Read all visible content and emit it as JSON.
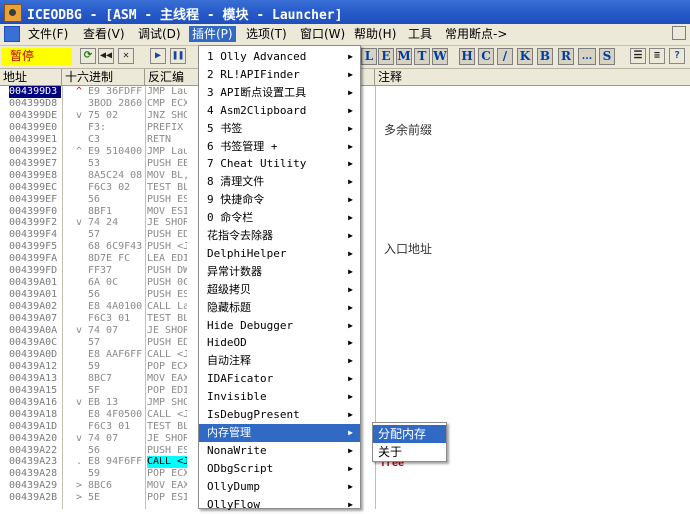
{
  "title": "ICEODBG - [ASM - 主线程 - 模块 - Launcher]",
  "menubar": [
    {
      "label": "文件(F)"
    },
    {
      "label": "查看(V)"
    },
    {
      "label": "调试(D)"
    },
    {
      "label": "插件(P)"
    },
    {
      "label": "选项(T)"
    },
    {
      "label": "窗口(W)"
    },
    {
      "label": "帮助(H)"
    },
    {
      "label": "工具"
    },
    {
      "label": "常用断点->"
    }
  ],
  "toolbar": {
    "status": "暂停",
    "letters": [
      "L",
      "E",
      "M",
      "T",
      "W",
      "H",
      "C",
      "/",
      "K",
      "B",
      "R",
      "...",
      "S"
    ]
  },
  "columns": {
    "addr": "地址",
    "hex": "十六进制",
    "disasm": "反汇编",
    "comment": "注释"
  },
  "rows": [
    {
      "addr": "004399D3",
      "mark": "^",
      "hex": "E9 36FDFF",
      "asm": "JMP Lau"
    },
    {
      "addr": "004399D8",
      "mark": "",
      "hex": "3BOD 2860",
      "asm": "CMP ECX"
    },
    {
      "addr": "004399DE",
      "mark": "v",
      "hex": "75 02",
      "asm": "JNZ SHO"
    },
    {
      "addr": "004399E0",
      "mark": "",
      "hex": "F3:",
      "asm": "PREFIX"
    },
    {
      "addr": "004399E1",
      "mark": "",
      "hex": "C3",
      "asm": "RETN"
    },
    {
      "addr": "004399E2",
      "mark": "^",
      "hex": "E9 510400",
      "asm": "JMP Lau"
    },
    {
      "addr": "004399E7",
      "mark": "",
      "hex": "53",
      "asm": "PUSH EB"
    },
    {
      "addr": "004399E8",
      "mark": "",
      "hex": "8A5C24 08",
      "asm": "MOV BL,"
    },
    {
      "addr": "004399EC",
      "mark": "",
      "hex": "F6C3 02",
      "asm": "TEST BL"
    },
    {
      "addr": "004399EF",
      "mark": "",
      "hex": "56",
      "asm": "PUSH ES"
    },
    {
      "addr": "004399F0",
      "mark": "",
      "hex": "8BF1",
      "asm": "MOV ESI"
    },
    {
      "addr": "004399F2",
      "mark": "v",
      "hex": "74 24",
      "asm": "JE SHOR"
    },
    {
      "addr": "004399F4",
      "mark": "",
      "hex": "57",
      "asm": "PUSH ED"
    },
    {
      "addr": "004399F5",
      "mark": "",
      "hex": "68 6C9F43",
      "asm": "PUSH <J"
    },
    {
      "addr": "004399FA",
      "mark": "",
      "hex": "8D7E FC",
      "asm": "LEA EDI"
    },
    {
      "addr": "004399FD",
      "mark": "",
      "hex": "FF37",
      "asm": "PUSH DW"
    },
    {
      "addr": "00439A01",
      "mark": "",
      "hex": "6A 0C",
      "asm": "PUSH 0C"
    },
    {
      "addr": "00439A01",
      "mark": "",
      "hex": "56",
      "asm": "PUSH ES"
    },
    {
      "addr": "00439A02",
      "mark": "",
      "hex": "E8 4A0100",
      "asm": "CALL La"
    },
    {
      "addr": "00439A07",
      "mark": "",
      "hex": "F6C3 01",
      "asm": "TEST BL"
    },
    {
      "addr": "00439A0A",
      "mark": "v",
      "hex": "74 07",
      "asm": "JE SHOR"
    },
    {
      "addr": "00439A0C",
      "mark": "",
      "hex": "57",
      "asm": "PUSH ED"
    },
    {
      "addr": "00439A0D",
      "mark": "",
      "hex": "E8 AAF6FF",
      "asm": "CALL <J"
    },
    {
      "addr": "00439A12",
      "mark": "",
      "hex": "59",
      "asm": "POP ECX"
    },
    {
      "addr": "00439A13",
      "mark": "",
      "hex": "8BC7",
      "asm": "MOV EAX"
    },
    {
      "addr": "00439A15",
      "mark": "",
      "hex": "5F",
      "asm": "POP EDI"
    },
    {
      "addr": "00439A16",
      "mark": "v",
      "hex": "EB 13",
      "asm": "JMP SHO"
    },
    {
      "addr": "00439A18",
      "mark": "",
      "hex": "E8 4F0500",
      "asm": "CALL <J"
    },
    {
      "addr": "00439A1D",
      "mark": "",
      "hex": "F6C3 01",
      "asm": "TEST BL"
    },
    {
      "addr": "00439A20",
      "mark": "v",
      "hex": "74 07",
      "asm": "JE SHOR"
    },
    {
      "addr": "00439A22",
      "mark": "",
      "hex": "56",
      "asm": "PUSH ES"
    },
    {
      "addr": "00439A23",
      "mark": ".",
      "hex": "E8 94F6FF",
      "asm": "CALL <J"
    },
    {
      "addr": "00439A28",
      "mark": "",
      "hex": "59",
      "asm": "POP ECX"
    },
    {
      "addr": "00439A29",
      "mark": ">",
      "hex": "8BC6",
      "asm": "MOV EAX"
    },
    {
      "addr": "00439A2B",
      "mark": ">",
      "hex": "5E",
      "asm": "POP ESI"
    }
  ],
  "comments": {
    "c1": "多余前缀",
    "c2": "入口地址",
    "free": "free"
  },
  "plugin_menu": [
    {
      "label": "1 Olly Advanced",
      "arrow": true
    },
    {
      "label": "2 RL!APIFinder",
      "arrow": true
    },
    {
      "label": "3 API断点设置工具",
      "arrow": true
    },
    {
      "label": "4 Asm2Clipboard",
      "arrow": true
    },
    {
      "label": "5 书签",
      "arrow": true
    },
    {
      "label": "6 书签管理 +",
      "arrow": true
    },
    {
      "label": "7 Cheat Utility",
      "arrow": true
    },
    {
      "label": "8 清理文件",
      "arrow": true
    },
    {
      "label": "9 快捷命令",
      "arrow": true
    },
    {
      "label": "0 命令栏",
      "arrow": true
    },
    {
      "label": "花指令去除器",
      "arrow": true
    },
    {
      "label": "DelphiHelper",
      "arrow": true
    },
    {
      "label": "异常计数器",
      "arrow": true
    },
    {
      "label": "超级拷贝",
      "arrow": true
    },
    {
      "label": "隐藏标题",
      "arrow": true
    },
    {
      "label": "Hide Debugger",
      "arrow": true
    },
    {
      "label": "HideOD",
      "arrow": true
    },
    {
      "label": "自动注释",
      "arrow": true
    },
    {
      "label": "IDAFicator",
      "arrow": true
    },
    {
      "label": "Invisible",
      "arrow": true
    },
    {
      "label": "IsDebugPresent",
      "arrow": true
    },
    {
      "label": "内存管理",
      "arrow": true
    },
    {
      "label": "NonaWrite",
      "arrow": true
    },
    {
      "label": "ODbgScript",
      "arrow": true
    },
    {
      "label": "OllyDump",
      "arrow": true
    },
    {
      "label": "OllyFlow",
      "arrow": true
    }
  ],
  "submenu": [
    {
      "label": "分配内存"
    },
    {
      "label": "关于"
    }
  ],
  "colors": {
    "title": "#2559c8",
    "menu_bg": "#ece9d8",
    "highlight": "#316ac5",
    "status_bg": "#ffff00"
  }
}
